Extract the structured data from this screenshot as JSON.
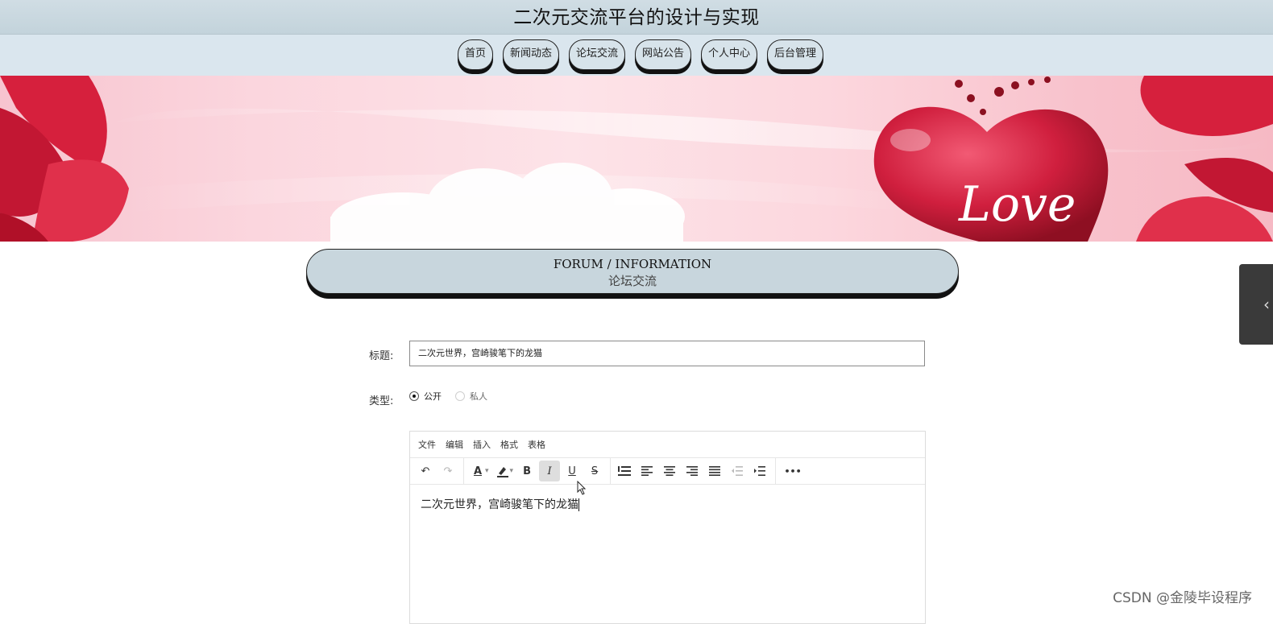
{
  "site": {
    "title": "二次元交流平台的设计与实现"
  },
  "nav": [
    {
      "label": "首页"
    },
    {
      "label": "新闻动态"
    },
    {
      "label": "论坛交流"
    },
    {
      "label": "网站公告"
    },
    {
      "label": "个人中心"
    },
    {
      "label": "后台管理"
    }
  ],
  "banner": {
    "text": "Love"
  },
  "section": {
    "title_en": "FORUM / INFORMATION",
    "title_cn": "论坛交流"
  },
  "form": {
    "title_label": "标题:",
    "title_value": "二次元世界，宫崎骏笔下的龙猫",
    "type_label": "类型:",
    "type_options": [
      "公开",
      "私人"
    ],
    "type_selected": "公开"
  },
  "editor": {
    "menu": [
      "文件",
      "编辑",
      "插入",
      "格式",
      "表格"
    ],
    "tools": {
      "undo": "↶",
      "redo": "↷",
      "font_color": "A",
      "bold": "B",
      "italic": "I",
      "underline": "U",
      "strike": "S",
      "more": "•••"
    },
    "content": "二次元世界，宫崎骏笔下的龙猫"
  },
  "side_tab": {
    "icon": "chevron-left-icon"
  },
  "watermark": "CSDN @金陵毕设程序"
}
